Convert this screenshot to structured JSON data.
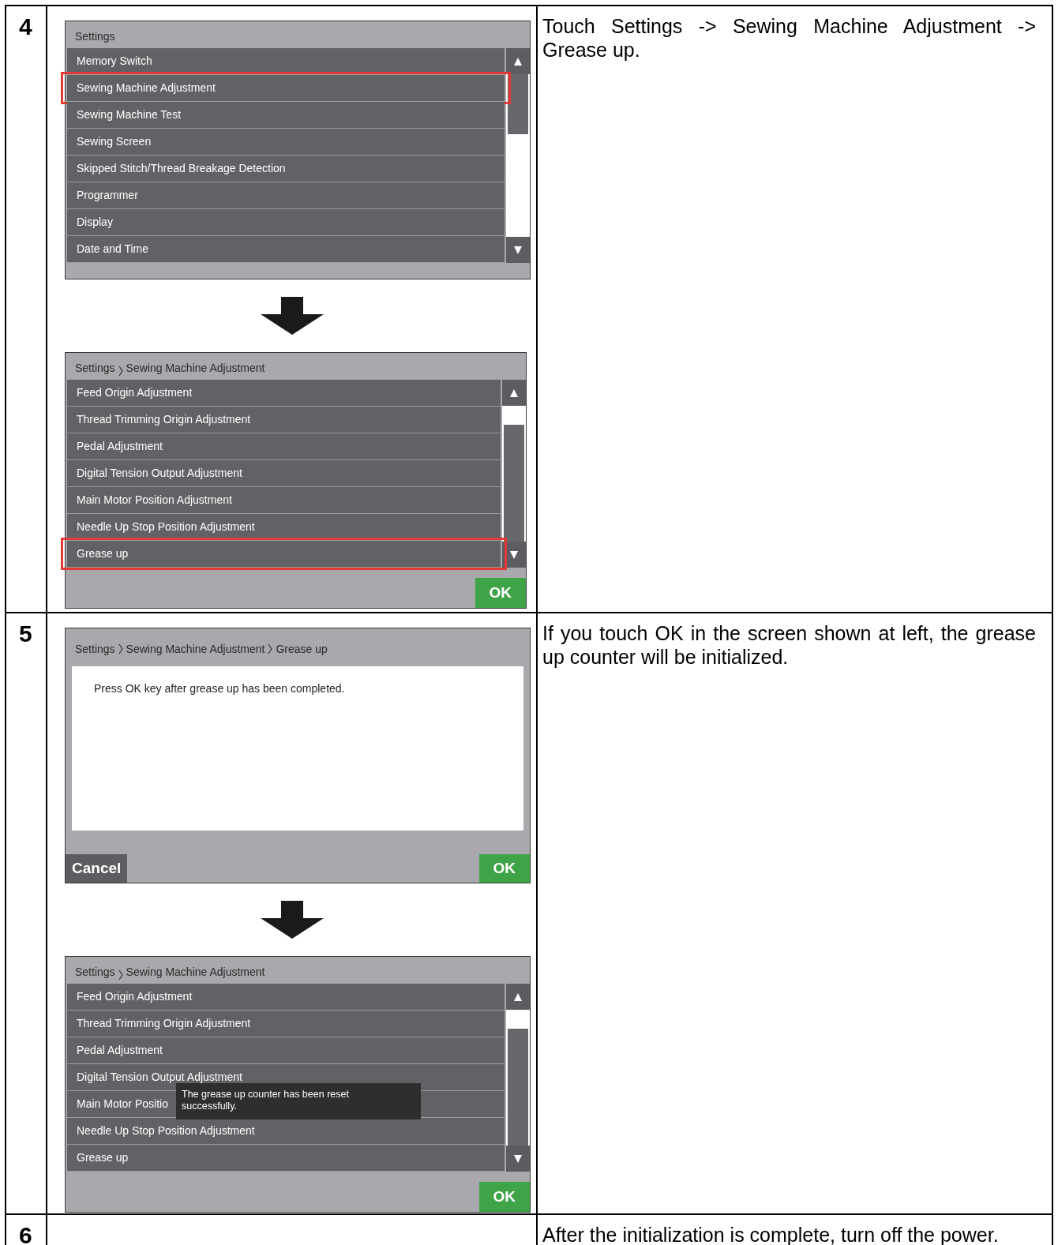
{
  "steps": [
    {
      "number": "4",
      "instruction": "Touch Settings -> Sewing Machine Adjustment -> Grease up.",
      "panels": [
        {
          "kind": "list",
          "breadcrumb": [
            "Settings"
          ],
          "items": [
            {
              "label": "Memory Switch",
              "highlighted": false
            },
            {
              "label": "Sewing Machine Adjustment",
              "highlighted": true
            },
            {
              "label": "Sewing Machine Test",
              "highlighted": false
            },
            {
              "label": "Sewing Screen",
              "highlighted": false
            },
            {
              "label": "Skipped Stitch/Thread Breakage Detection",
              "highlighted": false
            },
            {
              "label": "Programmer",
              "highlighted": false
            },
            {
              "label": "Display",
              "highlighted": false
            },
            {
              "label": "Date and Time",
              "highlighted": false
            }
          ]
        },
        {
          "kind": "list",
          "breadcrumb": [
            "Settings",
            "Sewing Machine Adjustment"
          ],
          "ok_button": "OK",
          "items": [
            {
              "label": "Feed Origin Adjustment",
              "highlighted": false
            },
            {
              "label": "Thread Trimming Origin Adjustment",
              "highlighted": false
            },
            {
              "label": "Pedal Adjustment",
              "highlighted": false
            },
            {
              "label": "Digital Tension Output Adjustment",
              "highlighted": false
            },
            {
              "label": "Main Motor Position Adjustment",
              "highlighted": false
            },
            {
              "label": "Needle Up Stop Position Adjustment",
              "highlighted": false
            },
            {
              "label": "Grease up",
              "highlighted": true
            }
          ]
        }
      ]
    },
    {
      "number": "5",
      "instruction": "If you touch OK in the screen shown at left, the grease up counter will be initialized.",
      "panels": [
        {
          "kind": "dialog",
          "breadcrumb": [
            "Settings",
            "Sewing Machine Adjustment",
            "Grease up"
          ],
          "message": "Press OK key after grease up has been completed.",
          "cancel_button": "Cancel",
          "ok_button": "OK"
        },
        {
          "kind": "list",
          "breadcrumb": [
            "Settings",
            "Sewing Machine Adjustment"
          ],
          "ok_button": "OK",
          "toast": "The grease up counter has been reset successfully.",
          "items": [
            {
              "label": "Feed Origin Adjustment",
              "highlighted": false
            },
            {
              "label": "Thread Trimming Origin Adjustment",
              "highlighted": false
            },
            {
              "label": "Pedal Adjustment",
              "highlighted": false
            },
            {
              "label": "Digital Tension Output Adjustment",
              "highlighted": false
            },
            {
              "label": "Main Motor Positio",
              "highlighted": false
            },
            {
              "label": "Needle Up Stop Position Adjustment",
              "highlighted": false
            },
            {
              "label": "Grease up",
              "highlighted": false
            }
          ]
        }
      ]
    },
    {
      "number": "6",
      "instruction": "After the initialization is complete, turn off the power."
    }
  ]
}
